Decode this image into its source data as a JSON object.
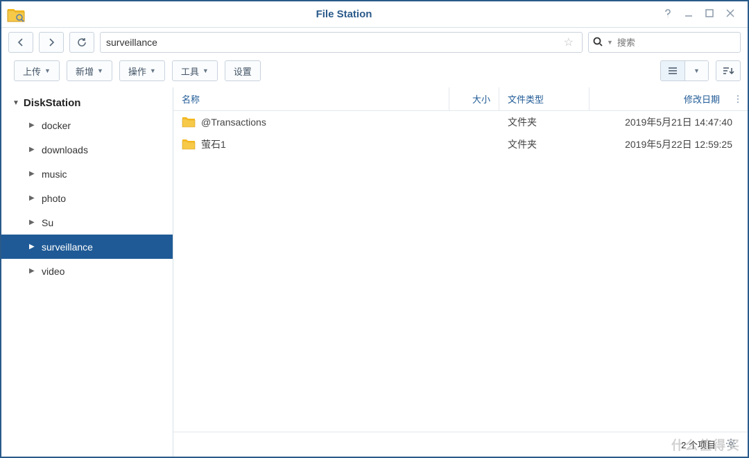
{
  "window": {
    "title": "File Station"
  },
  "nav": {
    "path": "surveillance",
    "search_placeholder": "搜索"
  },
  "toolbar": {
    "upload": "上传",
    "new": "新增",
    "action": "操作",
    "tools": "工具",
    "settings": "设置"
  },
  "tree": {
    "root": "DiskStation",
    "items": [
      {
        "label": "docker",
        "selected": false
      },
      {
        "label": "downloads",
        "selected": false
      },
      {
        "label": "music",
        "selected": false
      },
      {
        "label": "photo",
        "selected": false
      },
      {
        "label": "Su",
        "selected": false
      },
      {
        "label": "surveillance",
        "selected": true
      },
      {
        "label": "video",
        "selected": false
      }
    ]
  },
  "columns": {
    "name": "名称",
    "size": "大小",
    "type": "文件类型",
    "modified": "修改日期"
  },
  "rows": [
    {
      "name": "@Transactions",
      "size": "",
      "type": "文件夹",
      "date": "2019年5月21日 14:47:40"
    },
    {
      "name": "萤石1",
      "size": "",
      "type": "文件夹",
      "date": "2019年5月22日 12:59:25"
    }
  ],
  "status": {
    "count": "2 个项目"
  },
  "watermark": "什么值得买"
}
